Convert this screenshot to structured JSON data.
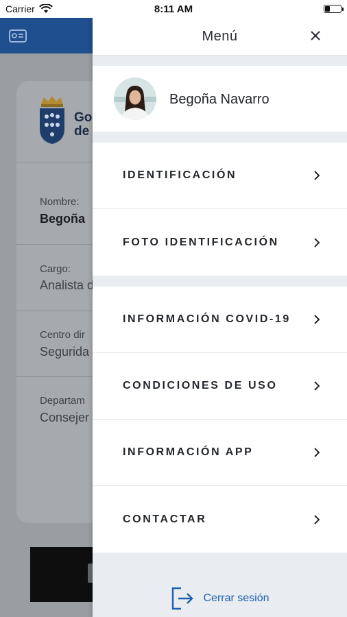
{
  "status_bar": {
    "carrier": "Carrier",
    "time": "8:11 AM"
  },
  "background": {
    "logo_text_line1": "Go",
    "logo_text_line2": "de",
    "fields": [
      {
        "label": "Nombre:",
        "value": "Begoña"
      },
      {
        "label": "Cargo:",
        "value": "Analista d"
      },
      {
        "label": "Centro dir",
        "value": "Segurida"
      },
      {
        "label": "Departam",
        "value": "Consejer"
      }
    ]
  },
  "drawer": {
    "title": "Menú",
    "profile_name": "Begoña Navarro",
    "group1": [
      {
        "label": "IDENTIFICACIÓN"
      },
      {
        "label": "FOTO IDENTIFICACIÓN"
      }
    ],
    "group2": [
      {
        "label": "INFORMACIÓN COVID-19"
      },
      {
        "label": "CONDICIONES DE USO"
      },
      {
        "label": "INFORMACIÓN APP"
      },
      {
        "label": "CONTACTAR"
      }
    ],
    "logout_label": "Cerrar sesión"
  },
  "colors": {
    "header_blue": "#1f4f8f",
    "link_blue": "#1d5fb0"
  },
  "icons": [
    "wifi-icon",
    "battery-icon",
    "id-card-icon",
    "close-icon",
    "chevron-right-icon",
    "logout-icon",
    "coat-of-arms-logo"
  ]
}
